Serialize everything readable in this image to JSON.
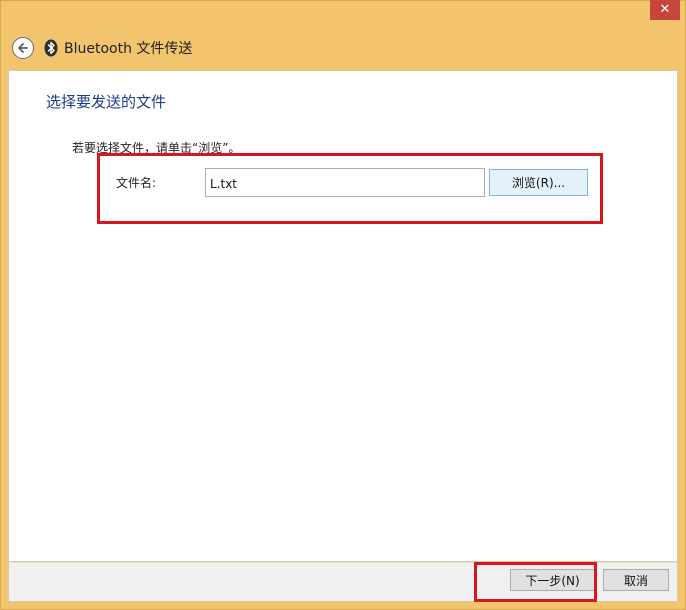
{
  "window": {
    "close_symbol": "✕"
  },
  "header": {
    "title": "Bluetooth 文件传送",
    "back_icon": "back-arrow-icon",
    "bt_icon": "bluetooth-icon"
  },
  "main": {
    "section_title": "选择要发送的文件",
    "instruction": "若要选择文件，请单击“浏览”。",
    "file_label": "文件名:",
    "file_value": "L.txt",
    "browse_label": "浏览(R)..."
  },
  "footer": {
    "next_label": "下一步(N)",
    "cancel_label": "取消"
  },
  "colors": {
    "frame": "#f2c46d",
    "title_blue": "#1e3c8c",
    "highlight_red": "#d6171c",
    "close_red": "#c7463b"
  }
}
